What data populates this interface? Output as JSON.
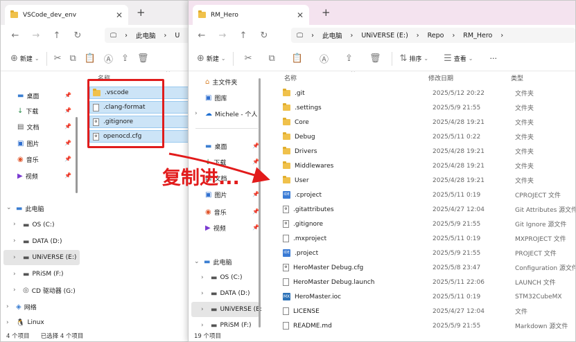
{
  "left_window": {
    "tab_title": "VSCode_dev_env",
    "breadcrumb": [
      "此电脑",
      "U"
    ],
    "toolbar": {
      "new_label": "新建"
    },
    "column_name": "名称",
    "files": [
      {
        "name": ".vscode",
        "icon": "folder-icon"
      },
      {
        "name": ".clang-format",
        "icon": "file-icon"
      },
      {
        "name": ".gitignore",
        "icon": "file-icon"
      },
      {
        "name": "openocd.cfg",
        "icon": "file-icon"
      }
    ],
    "quick_access": [
      {
        "label": "桌面",
        "icon": "desktop-icon"
      },
      {
        "label": "下载",
        "icon": "download-icon"
      },
      {
        "label": "文档",
        "icon": "document-icon"
      },
      {
        "label": "图片",
        "icon": "pictures-icon"
      },
      {
        "label": "音乐",
        "icon": "music-icon"
      },
      {
        "label": "视频",
        "icon": "video-icon"
      }
    ],
    "this_pc": "此电脑",
    "drives": [
      "OS (C:)",
      "DATA (D:)",
      "UNiVERSE (E:)",
      "PRiSM (F:)",
      "CD 驱动器 (G:)"
    ],
    "network": "网络",
    "linux": "Linux",
    "status": {
      "count": "4 个项目",
      "selected": "已选择 4 个项目"
    }
  },
  "right_window": {
    "tab_title": "RM_Hero",
    "breadcrumb": [
      "此电脑",
      "UNiVERSE (E:)",
      "Repo",
      "RM_Hero"
    ],
    "toolbar": {
      "new_label": "新建",
      "sort_label": "排序",
      "view_label": "查看",
      "more_label": "···"
    },
    "nav": {
      "home": "主文件夹",
      "gallery": "图库",
      "onedrive": "Michele - 个人",
      "quick_access": [
        {
          "label": "桌面",
          "icon": "desktop-icon"
        },
        {
          "label": "下载",
          "icon": "download-icon"
        },
        {
          "label": "文档",
          "icon": "document-icon"
        },
        {
          "label": "图片",
          "icon": "pictures-icon"
        },
        {
          "label": "音乐",
          "icon": "music-icon"
        },
        {
          "label": "视频",
          "icon": "video-icon"
        }
      ],
      "this_pc": "此电脑",
      "drives": [
        "OS (C:)",
        "DATA (D:)",
        "UNiVERSE (E:)",
        "PRiSM (F:)"
      ]
    },
    "columns": {
      "name": "名称",
      "date": "修改日期",
      "type": "类型"
    },
    "files": [
      {
        "name": ".git",
        "date": "2025/5/12 20:22",
        "type": "文件夹",
        "icon": "folder"
      },
      {
        "name": ".settings",
        "date": "2025/5/9 21:55",
        "type": "文件夹",
        "icon": "folder"
      },
      {
        "name": "Core",
        "date": "2025/4/28 19:21",
        "type": "文件夹",
        "icon": "folder"
      },
      {
        "name": "Debug",
        "date": "2025/5/11 0:22",
        "type": "文件夹",
        "icon": "folder"
      },
      {
        "name": "Drivers",
        "date": "2025/4/28 19:21",
        "type": "文件夹",
        "icon": "folder"
      },
      {
        "name": "Middlewares",
        "date": "2025/4/28 19:21",
        "type": "文件夹",
        "icon": "folder"
      },
      {
        "name": "User",
        "date": "2025/4/28 19:21",
        "type": "文件夹",
        "icon": "folder"
      },
      {
        "name": ".cproject",
        "date": "2025/5/11 0:19",
        "type": "CPROJECT 文件",
        "icon": "ide"
      },
      {
        "name": ".gitattributes",
        "date": "2025/4/27 12:04",
        "type": "Git Attributes 源文件",
        "icon": "gear"
      },
      {
        "name": ".gitignore",
        "date": "2025/5/9 21:55",
        "type": "Git Ignore 源文件",
        "icon": "gear"
      },
      {
        "name": ".mxproject",
        "date": "2025/5/11 0:19",
        "type": "MXPROJECT 文件",
        "icon": "file"
      },
      {
        "name": ".project",
        "date": "2025/5/9 21:55",
        "type": "PROJECT 文件",
        "icon": "ide"
      },
      {
        "name": "HeroMaster Debug.cfg",
        "date": "2025/5/8 23:47",
        "type": "Configuration 源文件",
        "icon": "gear"
      },
      {
        "name": "HeroMaster Debug.launch",
        "date": "2025/5/11 22:06",
        "type": "LAUNCH 文件",
        "icon": "file"
      },
      {
        "name": "HeroMaster.ioc",
        "date": "2025/5/11 0:19",
        "type": "STM32CubeMX",
        "icon": "mx"
      },
      {
        "name": "LICENSE",
        "date": "2025/4/27 12:04",
        "type": "文件",
        "icon": "file"
      },
      {
        "name": "README.md",
        "date": "2025/5/9 21:55",
        "type": "Markdown 源文件",
        "icon": "file"
      }
    ],
    "status": {
      "count": "19 个项目"
    }
  },
  "annotation": {
    "text": "复制进...",
    "color": "#e21b1b"
  }
}
